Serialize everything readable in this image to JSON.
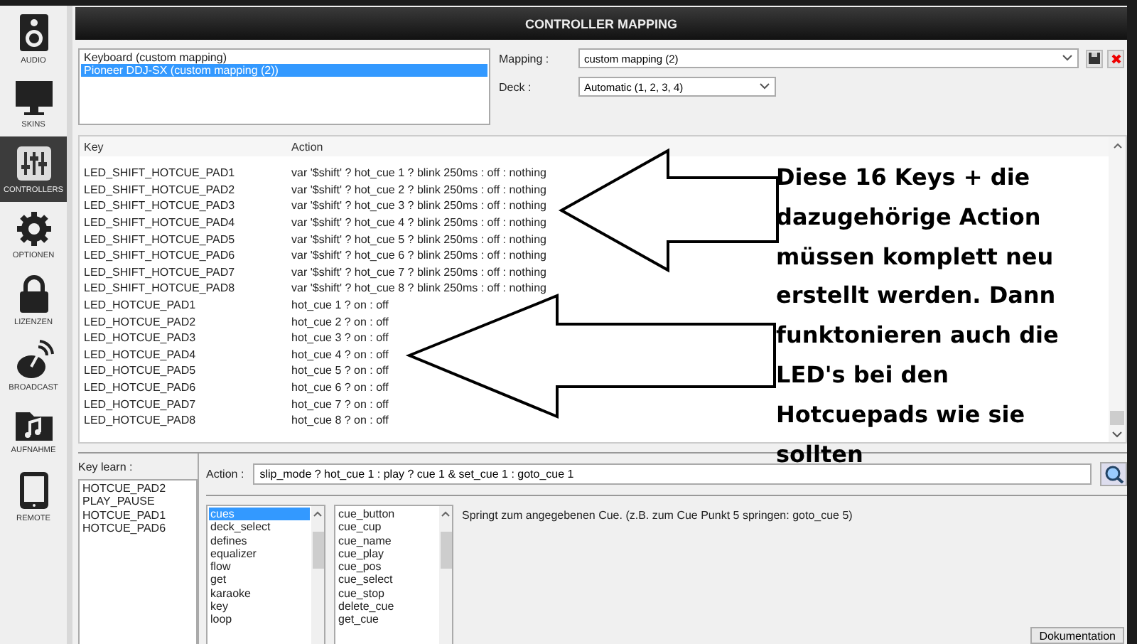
{
  "window": {
    "title": "CONTROLLER MAPPING"
  },
  "sidebar": {
    "items": [
      {
        "label": "AUDIO",
        "selected": false
      },
      {
        "label": "SKINS",
        "selected": false
      },
      {
        "label": "CONTROLLERS",
        "selected": true
      },
      {
        "label": "OPTIONEN",
        "selected": false
      },
      {
        "label": "LIZENZEN",
        "selected": false
      },
      {
        "label": "BROADCAST",
        "selected": false
      },
      {
        "label": "AUFNAHME",
        "selected": false
      },
      {
        "label": "REMOTE",
        "selected": false
      }
    ]
  },
  "devices": [
    {
      "label": "Keyboard (custom mapping)",
      "selected": false
    },
    {
      "label": "Pioneer DDJ-SX (custom mapping (2))",
      "selected": true
    }
  ],
  "mapping": {
    "label": "Mapping :",
    "value": "custom mapping (2)"
  },
  "deck": {
    "label": "Deck :",
    "value": "Automatic (1, 2, 3, 4)"
  },
  "table": {
    "columns": [
      "Key",
      "Action"
    ],
    "rows": [
      {
        "key": "LED_SHIFT_HOTCUE_PAD1",
        "action": "var '$shift' ? hot_cue 1 ? blink 250ms : off : nothing"
      },
      {
        "key": "LED_SHIFT_HOTCUE_PAD2",
        "action": "var '$shift' ? hot_cue 2 ? blink 250ms : off : nothing"
      },
      {
        "key": "LED_SHIFT_HOTCUE_PAD3",
        "action": "var '$shift' ? hot_cue 3 ? blink 250ms : off : nothing"
      },
      {
        "key": "LED_SHIFT_HOTCUE_PAD4",
        "action": "var '$shift' ? hot_cue 4 ? blink 250ms : off : nothing"
      },
      {
        "key": "LED_SHIFT_HOTCUE_PAD5",
        "action": "var '$shift' ? hot_cue 5 ? blink 250ms : off : nothing"
      },
      {
        "key": "LED_SHIFT_HOTCUE_PAD6",
        "action": "var '$shift' ? hot_cue 6 ? blink 250ms : off : nothing"
      },
      {
        "key": "LED_SHIFT_HOTCUE_PAD7",
        "action": "var '$shift' ? hot_cue 7 ? blink 250ms : off : nothing"
      },
      {
        "key": "LED_SHIFT_HOTCUE_PAD8",
        "action": "var '$shift' ? hot_cue 8 ? blink 250ms : off : nothing"
      },
      {
        "key": "LED_HOTCUE_PAD1",
        "action": "hot_cue 1 ? on : off"
      },
      {
        "key": "LED_HOTCUE_PAD2",
        "action": "hot_cue 2 ? on : off"
      },
      {
        "key": "LED_HOTCUE_PAD3",
        "action": "hot_cue 3 ? on : off"
      },
      {
        "key": "LED_HOTCUE_PAD4",
        "action": "hot_cue 4 ? on : off"
      },
      {
        "key": "LED_HOTCUE_PAD5",
        "action": "hot_cue 5 ? on : off"
      },
      {
        "key": "LED_HOTCUE_PAD6",
        "action": "hot_cue 6 ? on : off"
      },
      {
        "key": "LED_HOTCUE_PAD7",
        "action": "hot_cue 7 ? on : off"
      },
      {
        "key": "LED_HOTCUE_PAD8",
        "action": "hot_cue 8 ? on : off"
      }
    ]
  },
  "annotation": {
    "text": "Diese 16 Keys + die dazugehörige Action müssen komplett neu erstellt werden. Dann funktonieren auch die LED's bei den Hotcuepads wie sie sollten"
  },
  "key_learn": {
    "label": "Key learn :",
    "items": [
      "HOTCUE_PAD2",
      "PLAY_PAUSE",
      "HOTCUE_PAD1",
      "HOTCUE_PAD6"
    ]
  },
  "action": {
    "label": "Action :",
    "value": "slip_mode ? hot_cue 1 : play ? cue 1 & set_cue 1 : goto_cue 1"
  },
  "categories": [
    {
      "label": "cues",
      "selected": true
    },
    {
      "label": "deck_select",
      "selected": false
    },
    {
      "label": "defines",
      "selected": false
    },
    {
      "label": "equalizer",
      "selected": false
    },
    {
      "label": "flow",
      "selected": false
    },
    {
      "label": "get",
      "selected": false
    },
    {
      "label": "karaoke",
      "selected": false
    },
    {
      "label": "key",
      "selected": false
    },
    {
      "label": "loop",
      "selected": false
    }
  ],
  "commands": [
    {
      "label": "cue_button",
      "selected": false
    },
    {
      "label": "cue_cup",
      "selected": false
    },
    {
      "label": "cue_name",
      "selected": false
    },
    {
      "label": "cue_play",
      "selected": false
    },
    {
      "label": "cue_pos",
      "selected": false
    },
    {
      "label": "cue_select",
      "selected": false
    },
    {
      "label": "cue_stop",
      "selected": false
    },
    {
      "label": "delete_cue",
      "selected": false
    },
    {
      "label": "get_cue",
      "selected": false
    }
  ],
  "description": "Springt zum angegebenen Cue. (z.B. zum Cue Punkt 5 springen: goto_cue 5)",
  "buttons": [
    "Dokumentation"
  ]
}
